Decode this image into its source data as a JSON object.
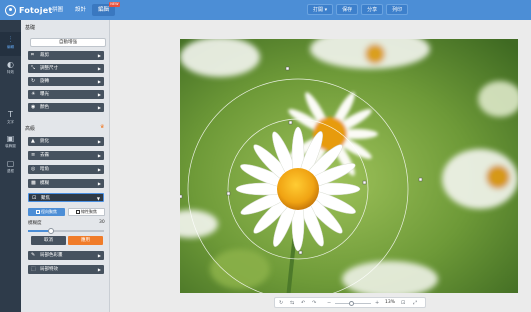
{
  "app": {
    "logo_text": "Fotojet"
  },
  "nav": {
    "tabs": [
      {
        "label": "拼圖"
      },
      {
        "label": "設計"
      },
      {
        "label": "編輯"
      }
    ],
    "new_badge": "NEW"
  },
  "actions": {
    "open": "打開 ▾",
    "save": "保存",
    "share": "分享",
    "print": "列印"
  },
  "iconbar": {
    "items": [
      {
        "icon": "sliders-icon",
        "label": "編輯"
      },
      {
        "icon": "effect-icon",
        "label": "特效"
      },
      {
        "icon": "text-icon",
        "label": "文字"
      },
      {
        "icon": "clipart-icon",
        "label": "裝飾圖"
      },
      {
        "icon": "frame-icon",
        "label": "邊框"
      }
    ]
  },
  "panel": {
    "basic_title": "基礎",
    "auto_enhance": "自動增強",
    "basic_tools": [
      {
        "label": "裁剪"
      },
      {
        "label": "調整尺寸"
      },
      {
        "label": "旋轉"
      },
      {
        "label": "曝光"
      },
      {
        "label": "顏色"
      }
    ],
    "advanced_title": "高級",
    "advanced_tools": [
      {
        "label": "銳化"
      },
      {
        "label": "去霧"
      },
      {
        "label": "暗角"
      },
      {
        "label": "模糊"
      },
      {
        "label": "聚焦"
      }
    ],
    "focus_options": {
      "radial": "徑向聚焦",
      "linear": "線性聚焦"
    },
    "blur_label": "模糊度",
    "blur_value": "30",
    "blur_fraction": 0.3,
    "cancel": "取消",
    "apply": "應用",
    "extra_tools": [
      {
        "label": "局部色彩畫"
      },
      {
        "label": "局部特效"
      }
    ]
  },
  "zoom": {
    "percent": "13%"
  },
  "colors": {
    "accent": "#4c8ed6",
    "apply": "#f07c2a",
    "dark_panel": "#2e3b4a"
  }
}
